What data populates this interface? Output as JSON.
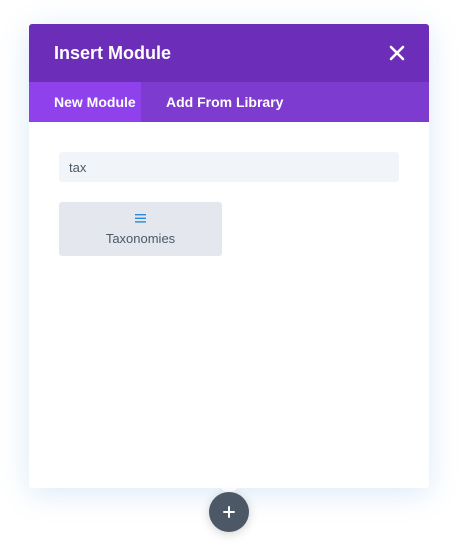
{
  "modal": {
    "title": "Insert Module",
    "close_icon": "close-icon"
  },
  "tabs": [
    {
      "label": "New Module",
      "active": true
    },
    {
      "label": "Add From Library",
      "active": false
    }
  ],
  "search": {
    "value": "tax"
  },
  "results": [
    {
      "label": "Taxonomies",
      "icon": "list-lines-icon"
    }
  ],
  "add_button": {
    "icon": "plus-icon"
  },
  "colors": {
    "header": "#6c2eb9",
    "tabs_bar": "#7e3bd0",
    "tab_active": "#8f42ec",
    "card_bg": "#e4e8ee",
    "icon_accent": "#2b87da",
    "add_button": "#4c5866"
  }
}
